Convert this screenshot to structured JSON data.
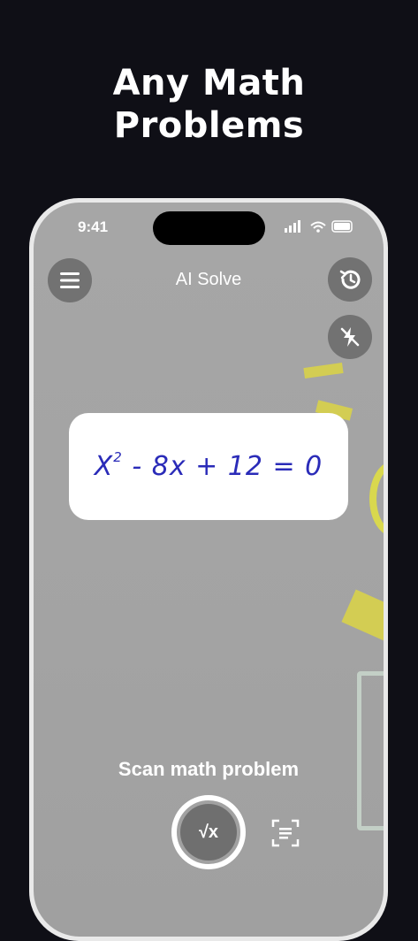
{
  "headline": {
    "line1": "Any Math",
    "line2": "Problems"
  },
  "status_bar": {
    "time": "9:41"
  },
  "header": {
    "title": "AI Solve",
    "menu_icon": "hamburger-menu-icon",
    "history_icon": "history-icon",
    "flash_icon": "flash-off-icon"
  },
  "problem_card": {
    "equation_base": "X",
    "equation_exp": "2",
    "equation_rest": "- 8x + 12 = 0"
  },
  "scan": {
    "label": "Scan math problem",
    "shutter_symbol": "√x",
    "text_scan_icon": "text-scan-icon"
  }
}
